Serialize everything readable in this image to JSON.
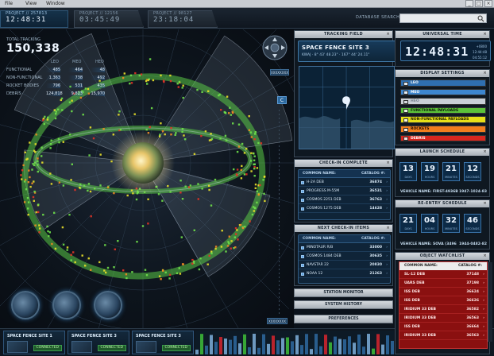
{
  "menu": {
    "items": [
      "File",
      "View",
      "Window"
    ],
    "controls": [
      "_",
      "□",
      "×"
    ]
  },
  "projects": [
    {
      "label": "PROJECT // 257813",
      "time": "12:48:31"
    },
    {
      "label": "PROJECT // 12156",
      "time": "03:45:49"
    },
    {
      "label": "PROJECT // 98127",
      "time": "23:18:04"
    }
  ],
  "search": {
    "label": "DATABASE SEARCH",
    "value": ""
  },
  "tracking": {
    "label": "TOTAL TRACKING",
    "total": "150,338",
    "columns": [
      "LEO",
      "MEO",
      "HEO"
    ],
    "rows": [
      {
        "name": "FUNCTIONAL",
        "values": [
          "485",
          "464",
          "48"
        ]
      },
      {
        "name": "NON-FUNCTIONAL",
        "values": [
          "1,363",
          "738",
          "492"
        ]
      },
      {
        "name": "ROCKET BODIES",
        "values": [
          "796",
          "531",
          "435"
        ]
      },
      {
        "name": "DEBRIS",
        "values": [
          "124,818",
          "9,823",
          "15,970"
        ]
      }
    ]
  },
  "view_badges": [
    "XXXXXXXX",
    "C",
    "XXXXXXXX"
  ],
  "sites": [
    {
      "name": "SPACE FENCE SITE 1",
      "status": "CONNECTED"
    },
    {
      "name": "SPACE FENCE SITE 3",
      "status": "CONNECTED"
    },
    {
      "name": "SPACE FENCE SITE 3",
      "status": "CONNECTED"
    }
  ],
  "tracking_field": {
    "title": "TRACKING FIELD",
    "site": "SPACE FENCE SITE 3",
    "coords": "KWAJ  ·  8° 43' 48.23\"  ·  167° 44' 24.11\""
  },
  "checkin": {
    "title": "CHECK-IN COMPLETE",
    "header": [
      "COMMON NAME:",
      "CATALOG #:"
    ],
    "rows": [
      {
        "name": "H-2A DEB",
        "cat": "36874"
      },
      {
        "name": "PROGRESS M-55M",
        "cat": "36531"
      },
      {
        "name": "COSMOS 2251 DEB",
        "cat": "36763"
      },
      {
        "name": "COSMOS 1275 DEB",
        "cat": "14628"
      }
    ]
  },
  "next_checkin": {
    "title": "NEXT CHECK-IN ITEMS",
    "header": [
      "COMMON NAME:",
      "CATALOG #:"
    ],
    "rows": [
      {
        "name": "MINOTAUR R/B",
        "cat": "33000"
      },
      {
        "name": "COSMOS 1484 DEB",
        "cat": "30635"
      },
      {
        "name": "NAVSTAR 22",
        "cat": "20830"
      },
      {
        "name": "NOAA 12",
        "cat": "21263"
      }
    ]
  },
  "collapsed": [
    "STATION MONITOR",
    "SYSTEM HISTORY",
    "PREFERENCES"
  ],
  "universal_time": {
    "title": "UNIVERSAL TIME",
    "time": "12:48:31",
    "side": [
      "+0800",
      "12:44:48",
      "04:55:12"
    ]
  },
  "display_settings": {
    "title": "DISPLAY SETTINGS",
    "items": [
      {
        "label": "LEO",
        "bg": "#2f6fb0",
        "fg": "#ffffff",
        "checked": true
      },
      {
        "label": "MEO",
        "bg": "#3d86cf",
        "fg": "#ffffff",
        "checked": true
      },
      {
        "label": "HEO",
        "bg": "#c9cfd6",
        "fg": "#7a8490",
        "checked": false
      },
      {
        "label": "FUNCTIONAL PAYLOADS",
        "bg": "#5cc23a",
        "fg": "#0d1a08",
        "checked": true
      },
      {
        "label": "NON-FUNCTIONAL PAYLOADS",
        "bg": "#e6e018",
        "fg": "#222200",
        "checked": true
      },
      {
        "label": "ROCKETS",
        "bg": "#f07d1e",
        "fg": "#1e0e00",
        "checked": true
      },
      {
        "label": "DEBRIS",
        "bg": "#d8261e",
        "fg": "#ffffff",
        "checked": true
      }
    ]
  },
  "launch": {
    "title": "LAUNCH SCHEDULE",
    "units": [
      {
        "n": "13",
        "u": "DAYS"
      },
      {
        "n": "19",
        "u": "HOURS"
      },
      {
        "n": "21",
        "u": "MINUTES"
      },
      {
        "n": "12",
        "u": "SECONDS"
      }
    ],
    "vehicle": "VEHICLE NAME: FIRST-4936B",
    "vehicle_id": "1947-1024-83"
  },
  "reentry": {
    "title": "RE-ENTRY SCHEDULE",
    "units": [
      {
        "n": "21",
        "u": "DAYS"
      },
      {
        "n": "04",
        "u": "HOURS"
      },
      {
        "n": "32",
        "u": "MINUTES"
      },
      {
        "n": "46",
        "u": "SECONDS"
      }
    ],
    "vehicle": "VEHICLE NAME: SOVA (3496",
    "vehicle_id": "1944-0482-82"
  },
  "watchlist": {
    "title": "OBJECT WATCHLIST",
    "header": [
      "COMMON NAME:",
      "CATALOG #:"
    ],
    "rows": [
      {
        "name": "SL-12 DEB",
        "cat": "37148"
      },
      {
        "name": "UARS DEB",
        "cat": "37198"
      },
      {
        "name": "ISS DEB",
        "cat": "36624"
      },
      {
        "name": "ISS DEB",
        "cat": "36626"
      },
      {
        "name": "IRIDIUM 33 DEB",
        "cat": "36582"
      },
      {
        "name": "IRIDIUM 33 DEB",
        "cat": "36563"
      },
      {
        "name": "ISS DEB",
        "cat": "36664"
      },
      {
        "name": "IRIDIUM 33 DEB",
        "cat": "36563"
      }
    ]
  },
  "colors": {
    "accent": "#3f79a8",
    "panel": "#0f1821",
    "header": "#c9cdd3",
    "alert": "#8a1010"
  }
}
